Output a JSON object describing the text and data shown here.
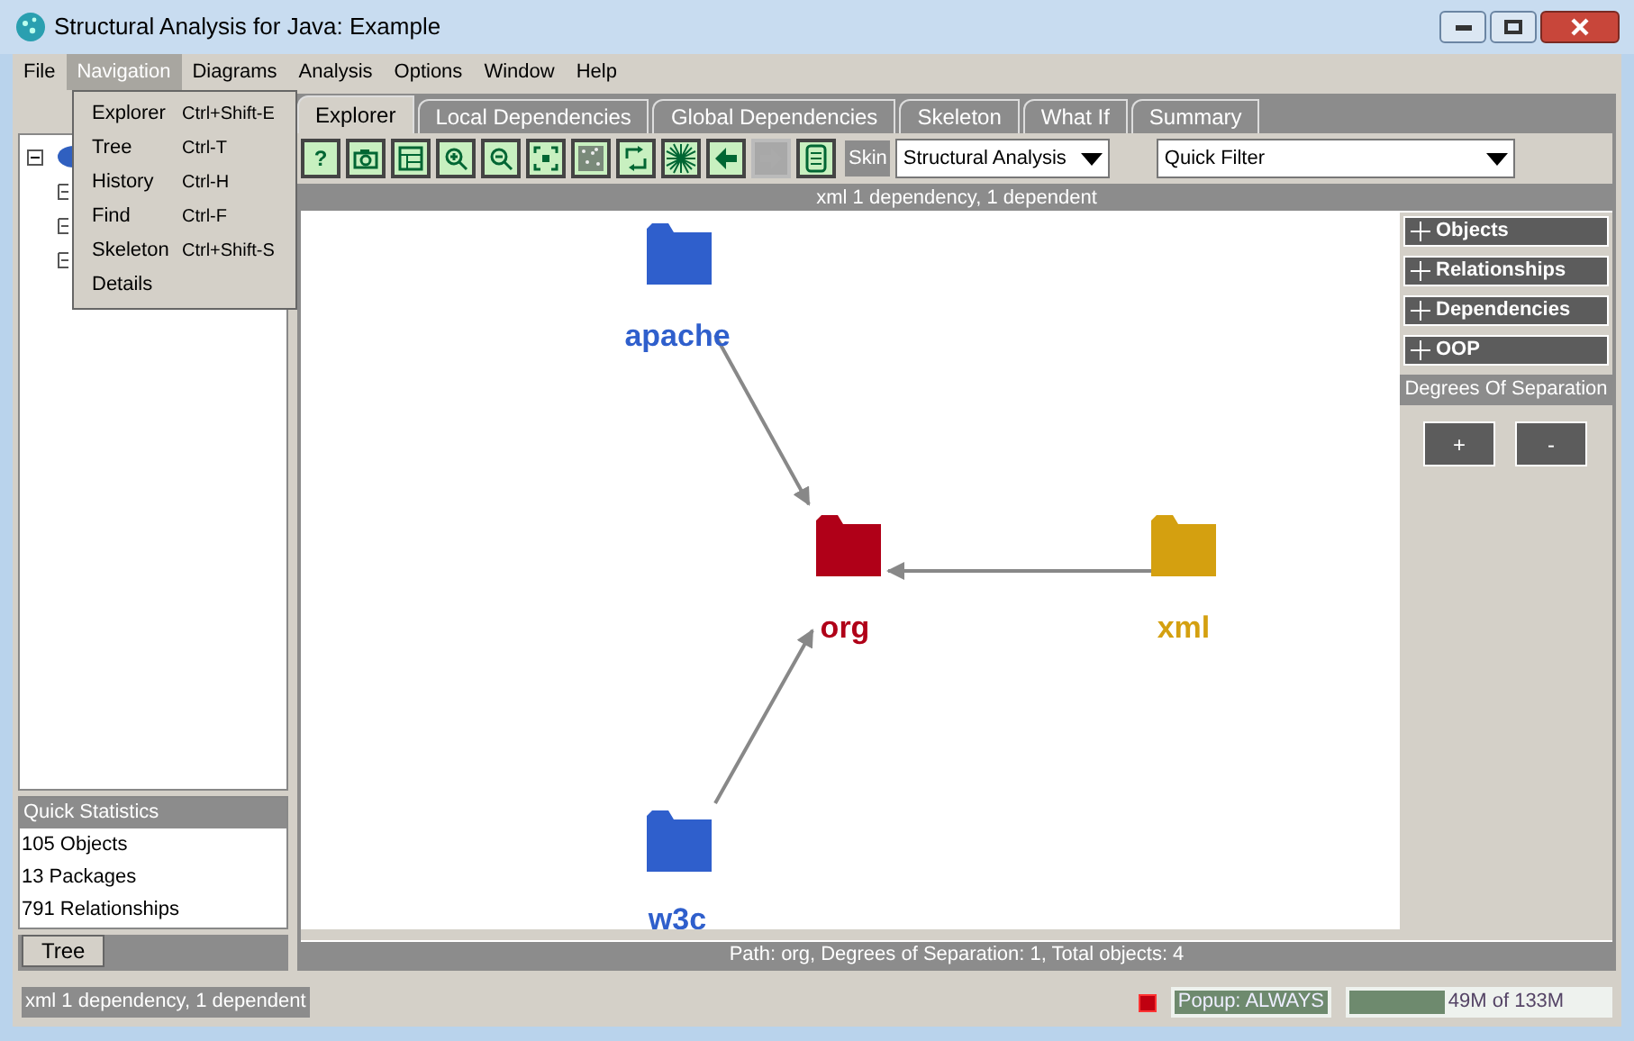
{
  "window": {
    "title": "Structural Analysis for Java: Example"
  },
  "menu_bar": [
    {
      "label": "File",
      "selected": false
    },
    {
      "label": "Navigation",
      "selected": true
    },
    {
      "label": "Diagrams",
      "selected": false
    },
    {
      "label": "Analysis",
      "selected": false
    },
    {
      "label": "Options",
      "selected": false
    },
    {
      "label": "Window",
      "selected": false
    },
    {
      "label": "Help",
      "selected": false
    }
  ],
  "navigation_menu": [
    {
      "label": "Explorer",
      "shortcut": "Ctrl+Shift-E"
    },
    {
      "label": "Tree",
      "shortcut": "Ctrl-T"
    },
    {
      "label": "History",
      "shortcut": "Ctrl-H"
    },
    {
      "label": "Find",
      "shortcut": "Ctrl-F"
    },
    {
      "label": "Skeleton",
      "shortcut": "Ctrl+Shift-S"
    },
    {
      "label": "Details"
    }
  ],
  "quick_statistics": {
    "title": "Quick Statistics",
    "items": [
      "105 Objects",
      "13 Packages",
      "791 Relationships"
    ]
  },
  "left_tabs": [
    {
      "label": "Tree",
      "selected": true
    }
  ],
  "tabs": [
    {
      "label": "Explorer",
      "selected": true
    },
    {
      "label": "Local Dependencies",
      "selected": false
    },
    {
      "label": "Global Dependencies",
      "selected": false
    },
    {
      "label": "Skeleton",
      "selected": false
    },
    {
      "label": "What If",
      "selected": false
    },
    {
      "label": "Summary",
      "selected": false
    }
  ],
  "toolbar": [
    {
      "kind": "help",
      "label": "?",
      "disabled": false
    },
    {
      "kind": "camera",
      "disabled": false
    },
    {
      "kind": "table",
      "disabled": false
    },
    {
      "kind": "zoom_in",
      "disabled": false
    },
    {
      "kind": "zoom_out",
      "disabled": false
    },
    {
      "kind": "fit",
      "disabled": false
    },
    {
      "kind": "noise",
      "disabled": false
    },
    {
      "kind": "refresh",
      "disabled": false
    },
    {
      "kind": "burst",
      "disabled": false
    },
    {
      "kind": "back",
      "disabled": false
    },
    {
      "kind": "forward",
      "disabled": true
    },
    {
      "kind": "document",
      "disabled": false
    }
  ],
  "skin": {
    "label": "Skin",
    "value": "Structural Analysis"
  },
  "quick_filter": {
    "value": "Quick Filter"
  },
  "header": "xml 1 dependency, 1 dependent",
  "graph": {
    "nodes": [
      {
        "label": "apache",
        "color": "#2f5fcc"
      },
      {
        "label": "org",
        "color": "#b00018"
      },
      {
        "label": "xml",
        "color": "#d4a010"
      },
      {
        "label": "w3c",
        "color": "#2f5fcc"
      }
    ]
  },
  "side_sections": [
    "Objects",
    "Relationships",
    "Dependencies",
    "OOP"
  ],
  "degrees": {
    "title": "Degrees Of Separation",
    "buttons": [
      "+",
      "-"
    ]
  },
  "path_bar": "Path: org,  Degrees of Separation: 1, Total objects: 4",
  "status_bar": {
    "message": "xml 1 dependency, 1 dependent",
    "popup": "Popup: ALWAYS",
    "memory": {
      "text": "49M of 133M",
      "level": 0.37
    }
  }
}
